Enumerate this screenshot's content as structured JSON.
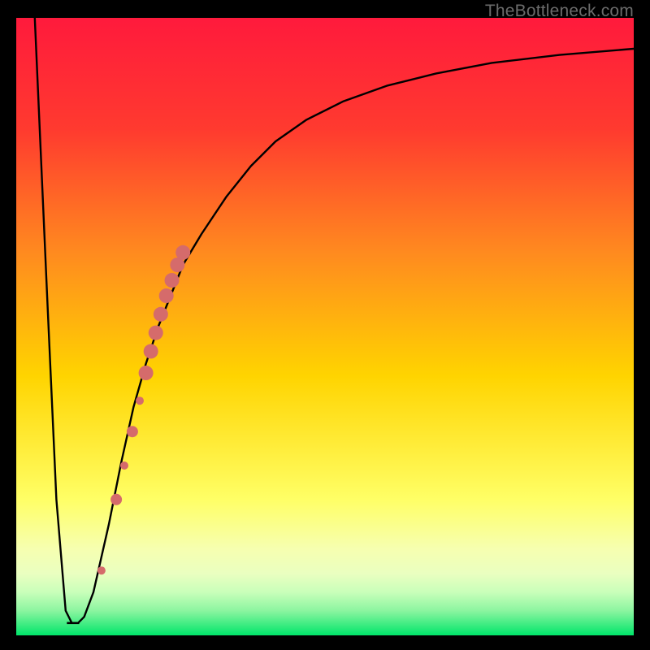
{
  "watermark": "TheBottleneck.com",
  "colors": {
    "top": "#ff1a3c",
    "upper_mid": "#ff7a1f",
    "mid": "#ffd400",
    "lower_mid": "#f6ff7a",
    "green_band_top": "#d9ffa8",
    "green": "#00e56a",
    "frame": "#000000",
    "curve": "#000000",
    "marker": "#d56b6b"
  },
  "chart_data": {
    "type": "line",
    "title": "",
    "xlabel": "",
    "ylabel": "",
    "xlim": [
      0,
      100
    ],
    "ylim": [
      0,
      100
    ],
    "black_curve": {
      "note": "Values are estimated off the plot. y = bottleneck % (100 = top/red, 0 = bottom/green). x is normalized horizontal position.",
      "x": [
        3,
        5,
        6.5,
        8,
        9,
        10,
        11,
        12.5,
        15,
        17,
        19,
        21,
        23,
        25,
        27,
        30,
        34,
        38,
        42,
        47,
        53,
        60,
        68,
        77,
        88,
        100
      ],
      "y": [
        100,
        55,
        22,
        4,
        2,
        2,
        3,
        7,
        18,
        28,
        37,
        44,
        50,
        55,
        60,
        65,
        71,
        76,
        80,
        83.5,
        86.5,
        89,
        91,
        92.7,
        94,
        95
      ]
    },
    "flat_bottom": {
      "x": [
        8.2,
        10.2
      ],
      "y": [
        2,
        2
      ]
    },
    "markers_series": {
      "note": "Salmon markers along the rising branch; radius in plot-px.",
      "points": [
        {
          "x": 13.8,
          "y": 10.5,
          "r": 5
        },
        {
          "x": 16.2,
          "y": 22,
          "r": 7
        },
        {
          "x": 17.5,
          "y": 27.5,
          "r": 5
        },
        {
          "x": 18.8,
          "y": 33,
          "r": 7
        },
        {
          "x": 20.0,
          "y": 38,
          "r": 5
        },
        {
          "x": 21.0,
          "y": 42.5,
          "r": 9
        },
        {
          "x": 21.8,
          "y": 46,
          "r": 9
        },
        {
          "x": 22.6,
          "y": 49,
          "r": 9
        },
        {
          "x": 23.4,
          "y": 52,
          "r": 9
        },
        {
          "x": 24.3,
          "y": 55,
          "r": 9
        },
        {
          "x": 25.2,
          "y": 57.5,
          "r": 9
        },
        {
          "x": 26.1,
          "y": 60,
          "r": 9
        },
        {
          "x": 27.0,
          "y": 62,
          "r": 9
        }
      ]
    }
  }
}
